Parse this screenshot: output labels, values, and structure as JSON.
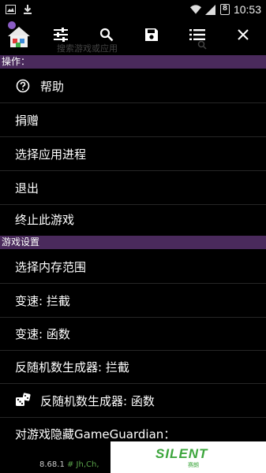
{
  "status_bar": {
    "time": "10:53",
    "battery_label": "8"
  },
  "toolbar": {
    "buttons": [
      {
        "icon": "home-app-icon"
      },
      {
        "icon": "sliders-icon"
      },
      {
        "icon": "search-icon"
      },
      {
        "icon": "save-icon"
      },
      {
        "icon": "list-icon"
      },
      {
        "icon": "close-icon"
      }
    ],
    "search_placeholder": "搜索游戏或应用"
  },
  "sections": {
    "actions": "操作：",
    "game_settings": "游戏设置"
  },
  "actions": [
    {
      "label": "帮助",
      "icon": "help-circle-icon"
    },
    {
      "label": "捐赠"
    },
    {
      "label": "选择应用进程"
    },
    {
      "label": "退出"
    },
    {
      "label": "终止此游戏"
    }
  ],
  "settings": [
    {
      "label": "选择内存范围"
    },
    {
      "label": "变速: 拦截"
    },
    {
      "label": "变速: 函数"
    },
    {
      "label": "反随机数生成器: 拦截"
    },
    {
      "label": "反随机数生成器: 函数",
      "icon": "dice-icon"
    },
    {
      "label": "对游戏隐藏GameGuardian："
    }
  ],
  "version": {
    "number": "8.68.1",
    "comment": "# Jh,Ch,"
  },
  "watermark": {
    "text": "SILENT",
    "sub": "赛朗"
  },
  "colors": {
    "section_bg": "#4a2a5c",
    "background": "#000000",
    "watermark": "#3da63d"
  }
}
